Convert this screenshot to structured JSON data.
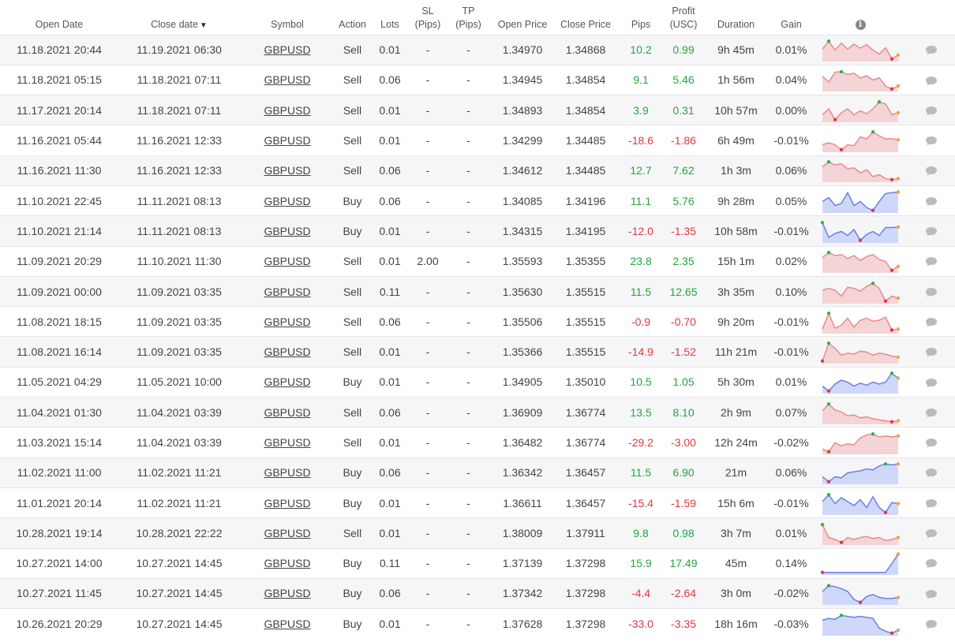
{
  "columns": {
    "open_date": "Open Date",
    "close_date": "Close date",
    "close_date_sort": "▼",
    "symbol": "Symbol",
    "action": "Action",
    "lots": "Lots",
    "sl_line1": "SL",
    "sl_line2": "(Pips)",
    "tp_line1": "TP",
    "tp_line2": "(Pips)",
    "open_price": "Open Price",
    "close_price": "Close Price",
    "pips": "Pips",
    "profit_line1": "Profit",
    "profit_line2": "(USC)",
    "duration": "Duration",
    "gain": "Gain",
    "info_icon": "info-icon"
  },
  "colors": {
    "positive": "#1fa83a",
    "negative": "#e2373f",
    "sell_line": "#e88c8c",
    "sell_fill": "#f4d4d6",
    "buy_line": "#6a7fe6",
    "buy_fill": "#cfd8fb",
    "marker_max": "#2fb34a",
    "marker_min": "#e2373f",
    "marker_end": "#f5a142",
    "comment_icon": "#bbbbbb"
  },
  "trades": [
    {
      "open_date": "11.18.2021 20:44",
      "close_date": "11.19.2021 06:30",
      "symbol": "GBPUSD",
      "action": "Sell",
      "lots": "0.01",
      "sl": "-",
      "tp": "-",
      "open_price": "1.34970",
      "close_price": "1.34868",
      "pips": "10.2",
      "profit": "0.99",
      "duration": "9h 45m",
      "gain": "0.01%",
      "spark": [
        0.55,
        0.95,
        0.5,
        0.85,
        0.55,
        0.8,
        0.6,
        0.78,
        0.5,
        0.3,
        0.62,
        0.05,
        0.25
      ]
    },
    {
      "open_date": "11.18.2021 05:15",
      "close_date": "11.18.2021 07:11",
      "symbol": "GBPUSD",
      "action": "Sell",
      "lots": "0.06",
      "sl": "-",
      "tp": "-",
      "open_price": "1.34945",
      "close_price": "1.34854",
      "pips": "9.1",
      "profit": "5.46",
      "duration": "1h 56m",
      "gain": "0.04%",
      "spark": [
        0.7,
        0.4,
        0.9,
        0.92,
        0.78,
        0.85,
        0.6,
        0.72,
        0.5,
        0.62,
        0.2,
        0.05,
        0.2
      ]
    },
    {
      "open_date": "11.17.2021 20:14",
      "close_date": "11.18.2021 07:11",
      "symbol": "GBPUSD",
      "action": "Sell",
      "lots": "0.01",
      "sl": "-",
      "tp": "-",
      "open_price": "1.34893",
      "close_price": "1.34854",
      "pips": "3.9",
      "profit": "0.31",
      "duration": "10h 57m",
      "gain": "0.00%",
      "spark": [
        0.3,
        0.6,
        0.05,
        0.4,
        0.6,
        0.3,
        0.5,
        0.35,
        0.6,
        0.95,
        0.85,
        0.3,
        0.4
      ]
    },
    {
      "open_date": "11.16.2021 05:44",
      "close_date": "11.16.2021 12:33",
      "symbol": "GBPUSD",
      "action": "Sell",
      "lots": "0.01",
      "sl": "-",
      "tp": "-",
      "open_price": "1.34299",
      "close_price": "1.34485",
      "pips": "-18.6",
      "profit": "-1.86",
      "duration": "6h 49m",
      "gain": "-0.01%",
      "spark": [
        0.3,
        0.4,
        0.3,
        0.05,
        0.3,
        0.25,
        0.7,
        0.6,
        0.95,
        0.75,
        0.6,
        0.6,
        0.55
      ]
    },
    {
      "open_date": "11.16.2021 11:30",
      "close_date": "11.16.2021 12:33",
      "symbol": "GBPUSD",
      "action": "Sell",
      "lots": "0.06",
      "sl": "-",
      "tp": "-",
      "open_price": "1.34612",
      "close_price": "1.34485",
      "pips": "12.7",
      "profit": "7.62",
      "duration": "1h 3m",
      "gain": "0.06%",
      "spark": [
        0.7,
        0.95,
        0.8,
        0.85,
        0.6,
        0.65,
        0.4,
        0.55,
        0.2,
        0.3,
        0.1,
        0.05,
        0.1
      ]
    },
    {
      "open_date": "11.10.2021 22:45",
      "close_date": "11.11.2021 08:13",
      "symbol": "GBPUSD",
      "action": "Buy",
      "lots": "0.06",
      "sl": "-",
      "tp": "-",
      "open_price": "1.34085",
      "close_price": "1.34196",
      "pips": "11.1",
      "profit": "5.76",
      "duration": "9h 28m",
      "gain": "0.05%",
      "spark": [
        0.5,
        0.7,
        0.3,
        0.4,
        0.95,
        0.3,
        0.5,
        0.2,
        0.05,
        0.5,
        0.9,
        0.95,
        0.98
      ]
    },
    {
      "open_date": "11.10.2021 21:14",
      "close_date": "11.11.2021 08:13",
      "symbol": "GBPUSD",
      "action": "Buy",
      "lots": "0.01",
      "sl": "-",
      "tp": "-",
      "open_price": "1.34315",
      "close_price": "1.34195",
      "pips": "-12.0",
      "profit": "-1.35",
      "duration": "10h 58m",
      "gain": "-0.01%",
      "spark": [
        0.95,
        0.2,
        0.4,
        0.5,
        0.3,
        0.6,
        0.05,
        0.35,
        0.5,
        0.3,
        0.7,
        0.7,
        0.72
      ]
    },
    {
      "open_date": "11.09.2021 20:29",
      "close_date": "11.10.2021 11:30",
      "symbol": "GBPUSD",
      "action": "Sell",
      "lots": "0.01",
      "sl": "2.00",
      "tp": "-",
      "open_price": "1.35593",
      "close_price": "1.35355",
      "pips": "23.8",
      "profit": "2.35",
      "duration": "15h 1m",
      "gain": "0.02%",
      "spark": [
        0.7,
        0.95,
        0.8,
        0.85,
        0.65,
        0.8,
        0.55,
        0.75,
        0.85,
        0.6,
        0.5,
        0.05,
        0.25
      ]
    },
    {
      "open_date": "11.09.2021 00:00",
      "close_date": "11.09.2021 03:35",
      "symbol": "GBPUSD",
      "action": "Sell",
      "lots": "0.11",
      "sl": "-",
      "tp": "-",
      "open_price": "1.35630",
      "close_price": "1.35515",
      "pips": "11.5",
      "profit": "12.65",
      "duration": "3h 35m",
      "gain": "0.10%",
      "spark": [
        0.6,
        0.7,
        0.6,
        0.3,
        0.75,
        0.7,
        0.55,
        0.8,
        0.95,
        0.7,
        0.05,
        0.3,
        0.2
      ]
    },
    {
      "open_date": "11.08.2021 18:15",
      "close_date": "11.09.2021 03:35",
      "symbol": "GBPUSD",
      "action": "Sell",
      "lots": "0.06",
      "sl": "-",
      "tp": "-",
      "open_price": "1.35506",
      "close_price": "1.35515",
      "pips": "-0.9",
      "profit": "-0.70",
      "duration": "9h 20m",
      "gain": "-0.01%",
      "spark": [
        0.15,
        0.95,
        0.2,
        0.35,
        0.7,
        0.25,
        0.6,
        0.7,
        0.55,
        0.6,
        0.75,
        0.1,
        0.15
      ]
    },
    {
      "open_date": "11.08.2021 16:14",
      "close_date": "11.09.2021 03:35",
      "symbol": "GBPUSD",
      "action": "Sell",
      "lots": "0.01",
      "sl": "-",
      "tp": "-",
      "open_price": "1.35366",
      "close_price": "1.35515",
      "pips": "-14.9",
      "profit": "-1.52",
      "duration": "11h 21m",
      "gain": "-0.01%",
      "spark": [
        0.05,
        0.95,
        0.7,
        0.35,
        0.45,
        0.4,
        0.55,
        0.5,
        0.35,
        0.45,
        0.4,
        0.3,
        0.25
      ]
    },
    {
      "open_date": "11.05.2021 04:29",
      "close_date": "11.05.2021 10:00",
      "symbol": "GBPUSD",
      "action": "Buy",
      "lots": "0.01",
      "sl": "-",
      "tp": "-",
      "open_price": "1.34905",
      "close_price": "1.35010",
      "pips": "10.5",
      "profit": "1.05",
      "duration": "5h 30m",
      "gain": "0.01%",
      "spark": [
        0.3,
        0.05,
        0.4,
        0.6,
        0.5,
        0.3,
        0.45,
        0.35,
        0.5,
        0.4,
        0.5,
        0.95,
        0.7
      ]
    },
    {
      "open_date": "11.04.2021 01:30",
      "close_date": "11.04.2021 03:39",
      "symbol": "GBPUSD",
      "action": "Sell",
      "lots": "0.06",
      "sl": "-",
      "tp": "-",
      "open_price": "1.36909",
      "close_price": "1.36774",
      "pips": "13.5",
      "profit": "8.10",
      "duration": "2h 9m",
      "gain": "0.07%",
      "spark": [
        0.6,
        0.95,
        0.65,
        0.55,
        0.35,
        0.4,
        0.25,
        0.3,
        0.2,
        0.15,
        0.1,
        0.05,
        0.1
      ]
    },
    {
      "open_date": "11.03.2021 15:14",
      "close_date": "11.04.2021 03:39",
      "symbol": "GBPUSD",
      "action": "Sell",
      "lots": "0.01",
      "sl": "-",
      "tp": "-",
      "open_price": "1.36482",
      "close_price": "1.36774",
      "pips": "-29.2",
      "profit": "-3.00",
      "duration": "12h 24m",
      "gain": "-0.02%",
      "spark": [
        0.2,
        0.05,
        0.5,
        0.35,
        0.45,
        0.4,
        0.75,
        0.9,
        0.95,
        0.8,
        0.85,
        0.8,
        0.85
      ]
    },
    {
      "open_date": "11.02.2021 11:00",
      "close_date": "11.02.2021 11:21",
      "symbol": "GBPUSD",
      "action": "Buy",
      "lots": "0.06",
      "sl": "-",
      "tp": "-",
      "open_price": "1.36342",
      "close_price": "1.36457",
      "pips": "11.5",
      "profit": "6.90",
      "duration": "21m",
      "gain": "0.06%",
      "spark": [
        0.3,
        0.05,
        0.3,
        0.25,
        0.5,
        0.55,
        0.6,
        0.7,
        0.65,
        0.85,
        0.95,
        0.9,
        0.95
      ]
    },
    {
      "open_date": "11.01.2021 20:14",
      "close_date": "11.02.2021 11:21",
      "symbol": "GBPUSD",
      "action": "Buy",
      "lots": "0.01",
      "sl": "-",
      "tp": "-",
      "open_price": "1.36611",
      "close_price": "1.36457",
      "pips": "-15.4",
      "profit": "-1.59",
      "duration": "15h 6m",
      "gain": "-0.01%",
      "spark": [
        0.6,
        0.95,
        0.5,
        0.8,
        0.6,
        0.4,
        0.7,
        0.3,
        0.85,
        0.3,
        0.05,
        0.55,
        0.5
      ]
    },
    {
      "open_date": "10.28.2021 19:14",
      "close_date": "10.28.2021 22:22",
      "symbol": "GBPUSD",
      "action": "Sell",
      "lots": "0.01",
      "sl": "-",
      "tp": "-",
      "open_price": "1.38009",
      "close_price": "1.37911",
      "pips": "9.8",
      "profit": "0.98",
      "duration": "3h 7m",
      "gain": "0.01%",
      "spark": [
        0.95,
        0.3,
        0.2,
        0.05,
        0.3,
        0.2,
        0.3,
        0.35,
        0.25,
        0.3,
        0.15,
        0.2,
        0.3
      ]
    },
    {
      "open_date": "10.27.2021 14:00",
      "close_date": "10.27.2021 14:45",
      "symbol": "GBPUSD",
      "action": "Buy",
      "lots": "0.11",
      "sl": "-",
      "tp": "-",
      "open_price": "1.37139",
      "close_price": "1.37298",
      "pips": "15.9",
      "profit": "17.49",
      "duration": "45m",
      "gain": "0.14%",
      "spark": [
        0.05,
        0.05,
        0.05,
        0.05,
        0.05,
        0.05,
        0.05,
        0.05,
        0.05,
        0.05,
        0.05,
        0.5,
        0.98
      ]
    },
    {
      "open_date": "10.27.2021 11:45",
      "close_date": "10.27.2021 14:45",
      "symbol": "GBPUSD",
      "action": "Buy",
      "lots": "0.06",
      "sl": "-",
      "tp": "-",
      "open_price": "1.37342",
      "close_price": "1.37298",
      "pips": "-4.4",
      "profit": "-2.64",
      "duration": "3h 0m",
      "gain": "-0.02%",
      "spark": [
        0.6,
        0.9,
        0.85,
        0.75,
        0.6,
        0.2,
        0.05,
        0.35,
        0.45,
        0.3,
        0.25,
        0.25,
        0.3
      ]
    },
    {
      "open_date": "10.26.2021 20:29",
      "close_date": "10.27.2021 14:45",
      "symbol": "GBPUSD",
      "action": "Buy",
      "lots": "0.01",
      "sl": "-",
      "tp": "-",
      "open_price": "1.37628",
      "close_price": "1.37298",
      "pips": "-33.0",
      "profit": "-3.35",
      "duration": "18h 16m",
      "gain": "-0.03%",
      "spark": [
        0.7,
        0.8,
        0.75,
        0.95,
        0.9,
        0.85,
        0.9,
        0.85,
        0.8,
        0.3,
        0.15,
        0.05,
        0.2
      ]
    }
  ]
}
